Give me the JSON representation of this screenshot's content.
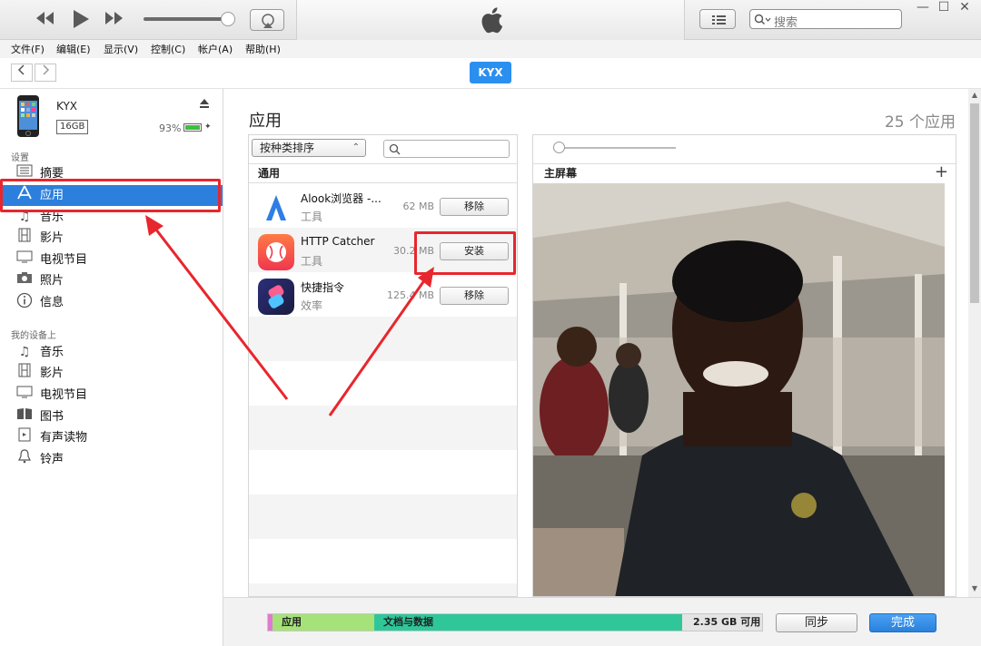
{
  "toolbar": {
    "search_placeholder": "搜索",
    "window_controls": [
      "—",
      "☐",
      "✕"
    ]
  },
  "menu": [
    "文件(F)",
    "编辑(E)",
    "显示(V)",
    "控制(C)",
    "帐户(A)",
    "帮助(H)"
  ],
  "nav": {
    "device_pill": "KYX"
  },
  "device": {
    "name": "KYX",
    "capacity": "16GB",
    "battery": "93%",
    "battery_level": 0.93
  },
  "sidebar": {
    "settings_label": "设置",
    "settings_items": [
      {
        "label": "摘要",
        "icon": "summary-icon"
      },
      {
        "label": "应用",
        "icon": "apps-icon"
      },
      {
        "label": "音乐",
        "icon": "music-icon"
      },
      {
        "label": "影片",
        "icon": "film-icon"
      },
      {
        "label": "电视节目",
        "icon": "tv-icon"
      },
      {
        "label": "照片",
        "icon": "camera-icon"
      },
      {
        "label": "信息",
        "icon": "info-icon"
      }
    ],
    "on_device_label": "我的设备上",
    "on_device_items": [
      {
        "label": "音乐",
        "icon": "music-icon"
      },
      {
        "label": "影片",
        "icon": "film-icon"
      },
      {
        "label": "电视节目",
        "icon": "tv-icon"
      },
      {
        "label": "图书",
        "icon": "book-icon"
      },
      {
        "label": "有声读物",
        "icon": "audiobook-icon"
      },
      {
        "label": "铃声",
        "icon": "bell-icon"
      }
    ]
  },
  "main": {
    "title": "应用",
    "count": "25 个应用",
    "sort_label": "按种类排序",
    "group_header": "通用",
    "apps": [
      {
        "name": "Alook浏览器 -...",
        "category": "工具",
        "size": "62 MB",
        "action": "移除"
      },
      {
        "name": "HTTP Catcher",
        "category": "工具",
        "size": "30.2 MB",
        "action": "安装"
      },
      {
        "name": "快捷指令",
        "category": "效率",
        "size": "125.4 MB",
        "action": "移除"
      }
    ],
    "home_screen_label": "主屏幕",
    "add_label": "+"
  },
  "storage": {
    "segments": [
      {
        "label": "",
        "color": "#e07ad0"
      },
      {
        "label": "应用",
        "color": "#a6e27a"
      },
      {
        "label": "文档与数据",
        "color": "#2fc79a"
      }
    ],
    "free_label": "2.35 GB 可用"
  },
  "buttons": {
    "sync": "同步",
    "done": "完成"
  },
  "colors": {
    "accent": "#2c7fdc",
    "annotation": "#e8262d"
  }
}
